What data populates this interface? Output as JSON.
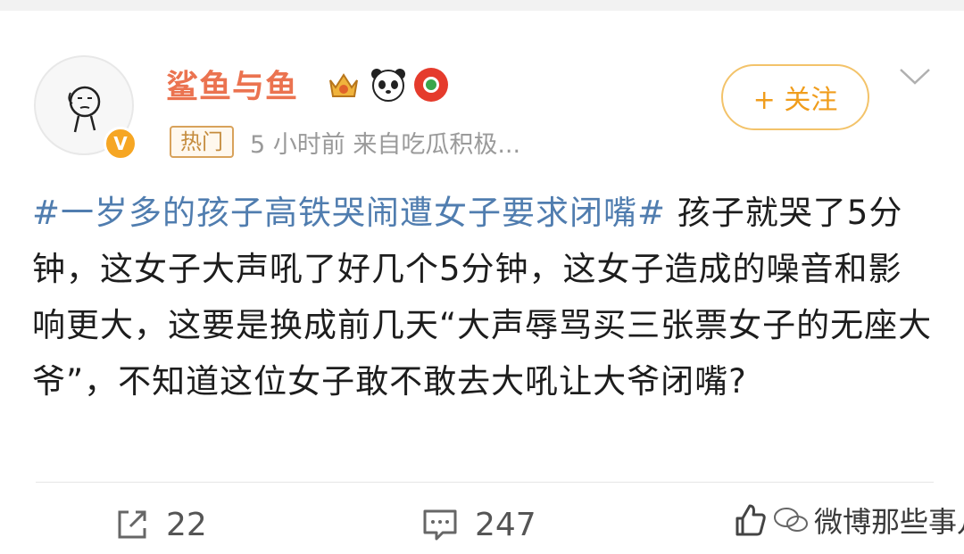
{
  "user": {
    "name": "鲨鱼与鱼",
    "avatar": "doodle-face-avatar",
    "verified_badge": "V"
  },
  "meta": {
    "hot_tag": "热门",
    "time_source": "5 小时前   来自吃瓜积极..."
  },
  "follow_button": "+ 关注",
  "post": {
    "topic": "#一岁多的孩子高铁哭闹遭女子要求闭嘴#",
    "text": " 孩子就哭了5分钟，这女子大声吼了好几个5分钟，这女子造成的噪音和影响更大，这要是换成前几天“大声辱骂买三张票女子的无座大爷”，不知道这位女子敢不敢去大吼让大爷闭嘴?"
  },
  "actions": {
    "share_count": "22",
    "comment_count": "247"
  },
  "watermark": "微博那些事儿",
  "colors": {
    "username": "#eb7350",
    "topic": "#507daf",
    "follow": "#f09d1c"
  }
}
